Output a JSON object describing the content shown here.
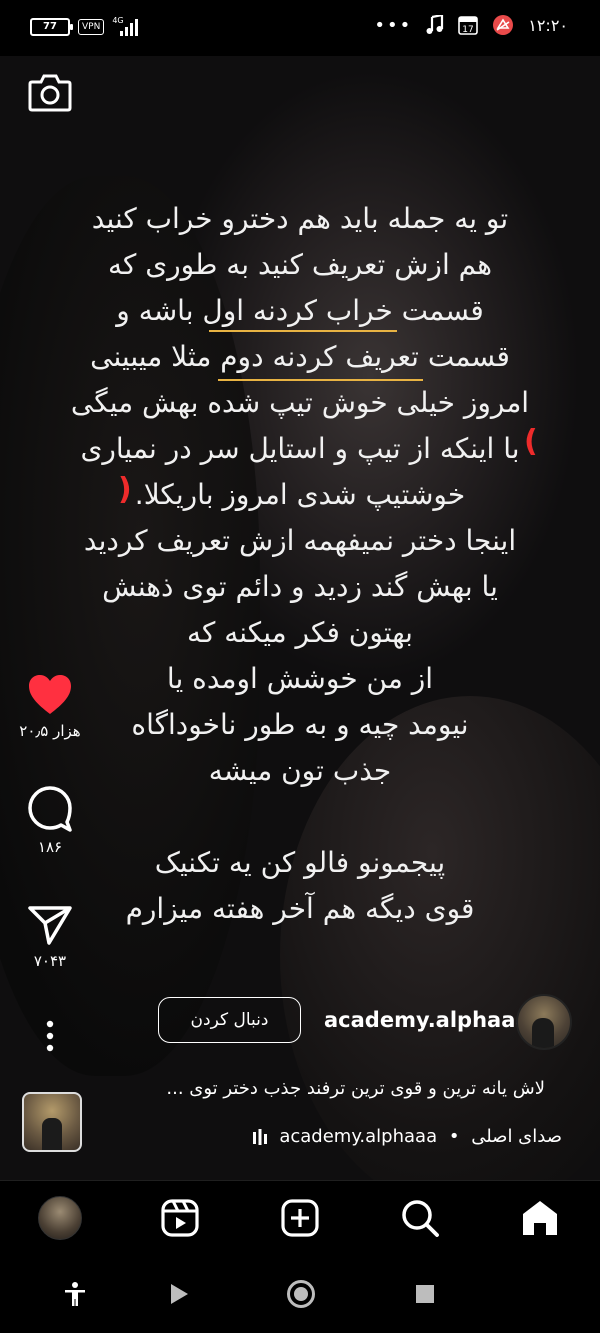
{
  "status_bar": {
    "battery": "77",
    "vpn": "VPN",
    "network": "4G",
    "more": "•••",
    "calendar_day": "17",
    "time": "۱۲:۲۰",
    "icons": [
      "battery-icon",
      "vpn-icon",
      "signal-icon",
      "music-icon",
      "calendar-icon",
      "app-notification-icon"
    ]
  },
  "reel": {
    "text_lines": [
      "تو یه جمله باید هم دخترو خراب کنید",
      "هم ازش تعریف کنید به طوری که",
      "قسمت خراب کردنه اول باشه و",
      "قسمت تعریف کردنه دوم مثلا میبینی",
      "امروز خیلی خوش تیپ شده بهش میگی",
      "با اینکه از تیپ و استایل سر در نمیاری",
      "خوشتیپ شدی امروز باریکلا.",
      "اینجا دختر نمیفهمه ازش تعریف کردید",
      "یا بهش گند زدید و دائم توی ذهنش",
      "بهتون فکر میکنه که",
      "از من خوشش اومده یا",
      "نیومد چیه و به طور ناخوداگاه",
      "جذب تون میشه",
      "",
      "پیجمونو فالو کن یه تکنیک",
      "قوی دیگه هم آخر هفته میزارم"
    ],
    "paren_open": "(",
    "paren_close": ")",
    "accent_underline_color": "#e8b343",
    "accent_paren_color": "#ee2b2b"
  },
  "actions": {
    "like_count": "۲۰٫۵ هزار",
    "comment_count": "۱۸۶",
    "share_count": "۷۰۴۳",
    "like_color": "#ff3040"
  },
  "author": {
    "username": "academy.alphaaa",
    "follow_label": "دنبال کردن"
  },
  "caption": "لاش یانه ترین و قوی ترین ترفند جذب دختر توی ...",
  "audio": {
    "label": "صدای اصلی",
    "separator": "•",
    "account": "academy.alphaaa"
  },
  "bottom_nav": [
    "home-icon",
    "search-icon",
    "create-icon",
    "reels-icon",
    "profile-avatar"
  ],
  "system_nav": [
    "recents-icon",
    "home-circle-icon",
    "back-play-icon",
    "accessibility-icon"
  ]
}
